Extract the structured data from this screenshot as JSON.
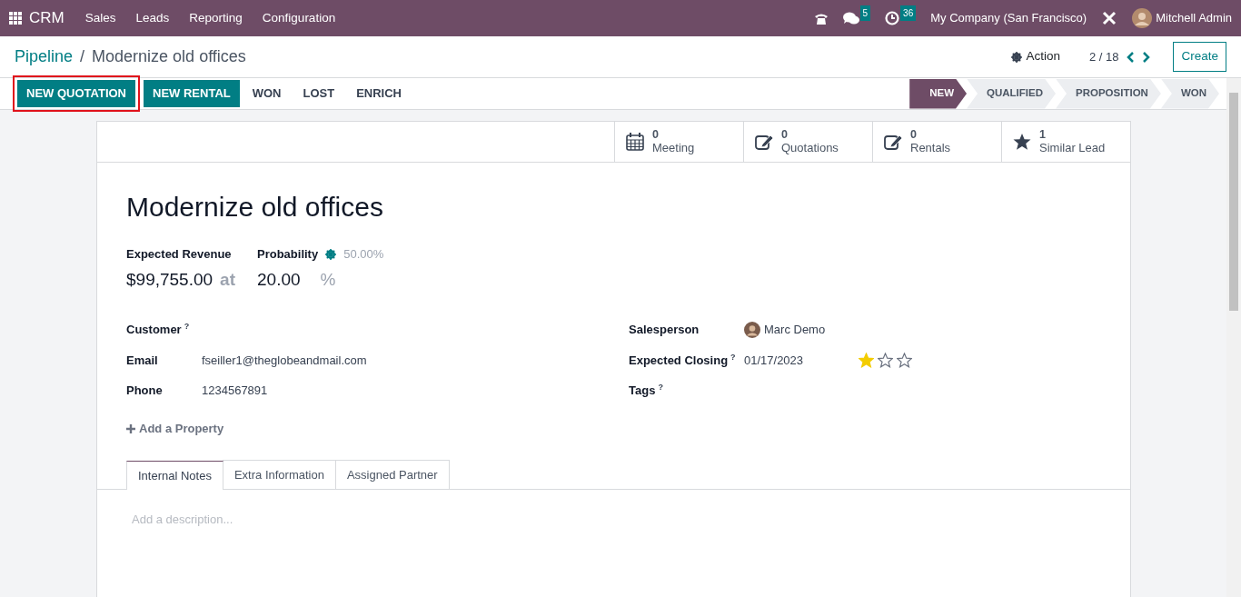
{
  "navbar": {
    "app": "CRM",
    "menu": [
      "Sales",
      "Leads",
      "Reporting",
      "Configuration"
    ],
    "messages_count": "5",
    "activities_count": "36",
    "company": "My Company (San Francisco)",
    "user": "Mitchell Admin"
  },
  "breadcrumb": {
    "items": [
      "Pipeline",
      "Modernize old offices"
    ],
    "separator": "/"
  },
  "control_panel": {
    "action": "Action",
    "pager": "2 / 18",
    "create": "Create"
  },
  "status_buttons": [
    {
      "label": "NEW QUOTATION",
      "kind": "primary",
      "highlighted": true
    },
    {
      "label": "NEW RENTAL",
      "kind": "primary",
      "highlighted": false
    },
    {
      "label": "WON",
      "kind": "link",
      "highlighted": false
    },
    {
      "label": "LOST",
      "kind": "link",
      "highlighted": false
    },
    {
      "label": "ENRICH",
      "kind": "link",
      "highlighted": false
    }
  ],
  "stages": [
    {
      "label": "NEW",
      "selected": true
    },
    {
      "label": "QUALIFIED",
      "selected": false
    },
    {
      "label": "PROPOSITION",
      "selected": false
    },
    {
      "label": "WON",
      "selected": false
    }
  ],
  "smart_buttons": [
    {
      "kind": "calendar",
      "count": "0",
      "label": "Meeting"
    },
    {
      "kind": "edit",
      "count": "0",
      "label": "Quotations"
    },
    {
      "kind": "edit",
      "count": "0",
      "label": "Rentals"
    },
    {
      "kind": "star",
      "count": "1",
      "label": "Similar Lead"
    }
  ],
  "title": "Modernize old offices",
  "revenue": {
    "label": "Expected Revenue",
    "value": "$99,755.00",
    "at": "at"
  },
  "probability": {
    "label": "Probability",
    "automated": "50.00%",
    "value": "20.00",
    "unit": "%"
  },
  "left_fields": [
    {
      "label": "Customer",
      "help": "?"
    },
    {
      "label": "Email",
      "value": "fseiller1@theglobeandmail.com"
    },
    {
      "label": "Phone",
      "value": "1234567891"
    }
  ],
  "add_property": "Add a Property",
  "salesperson": {
    "label": "Salesperson",
    "value": "Marc Demo"
  },
  "expected_closing": {
    "label": "Expected Closing",
    "help": "?",
    "value": "01/17/2023",
    "stars": 1
  },
  "tags": {
    "label": "Tags",
    "help": "?"
  },
  "tabs": [
    {
      "label": "Internal Notes",
      "selected": true
    },
    {
      "label": "Extra Information",
      "selected": false
    },
    {
      "label": "Assigned Partner",
      "selected": false
    }
  ],
  "description": {
    "placeholder": "Add a description..."
  }
}
